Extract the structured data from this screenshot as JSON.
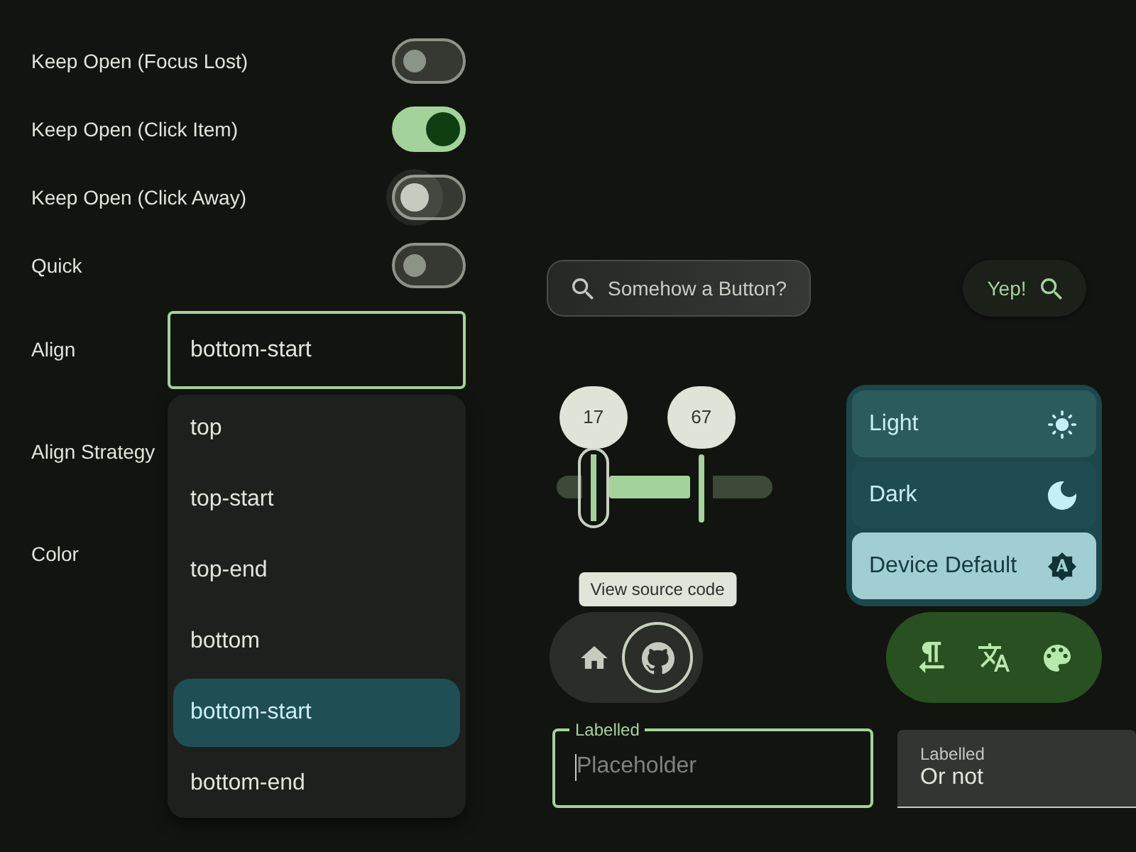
{
  "settings": [
    {
      "kind": "toggle",
      "label": "Keep Open (Focus Lost)",
      "on": false,
      "focused": false
    },
    {
      "kind": "toggle",
      "label": "Keep Open (Click Item)",
      "on": true,
      "focused": false
    },
    {
      "kind": "toggle",
      "label": "Keep Open (Click Away)",
      "on": false,
      "focused": true
    },
    {
      "kind": "toggle",
      "label": "Quick",
      "on": false,
      "focused": false
    },
    {
      "kind": "select",
      "label": "Align",
      "value": "bottom-start",
      "expanded": true,
      "options": [
        {
          "label": "top",
          "selected": false
        },
        {
          "label": "top-start",
          "selected": false
        },
        {
          "label": "top-end",
          "selected": false
        },
        {
          "label": "bottom",
          "selected": false
        },
        {
          "label": "bottom-start",
          "selected": true
        },
        {
          "label": "bottom-end",
          "selected": false
        }
      ]
    },
    {
      "kind": "label",
      "label": "Align Strategy"
    },
    {
      "kind": "label",
      "label": "Color"
    }
  ],
  "buttons": [
    {
      "kind": "outlined",
      "label": "Somehow a Button?"
    },
    {
      "kind": "tonal",
      "label": "Yep!"
    }
  ],
  "range_slider": {
    "handles": [
      {
        "label": "17",
        "level": 0.17,
        "focused": true
      },
      {
        "label": "67",
        "level": 0.67,
        "focused": false
      }
    ]
  },
  "theme_menu": {
    "items": [
      {
        "label": "Light",
        "selected": false,
        "hovered": true
      },
      {
        "label": "Dark",
        "selected": false,
        "hovered": false
      },
      {
        "label": "Device Default",
        "selected": true,
        "hovered": false
      }
    ]
  },
  "icon_buttons": [
    {
      "focused": false
    },
    {
      "focused": true,
      "tooltip": "View source code"
    }
  ],
  "text_fields": [
    {
      "kind": "outlined",
      "label": "Labelled",
      "placeholder": "Placeholder",
      "focused": true
    },
    {
      "kind": "filled",
      "label": "Labelled",
      "value": "Or not",
      "focused": false
    }
  ]
}
